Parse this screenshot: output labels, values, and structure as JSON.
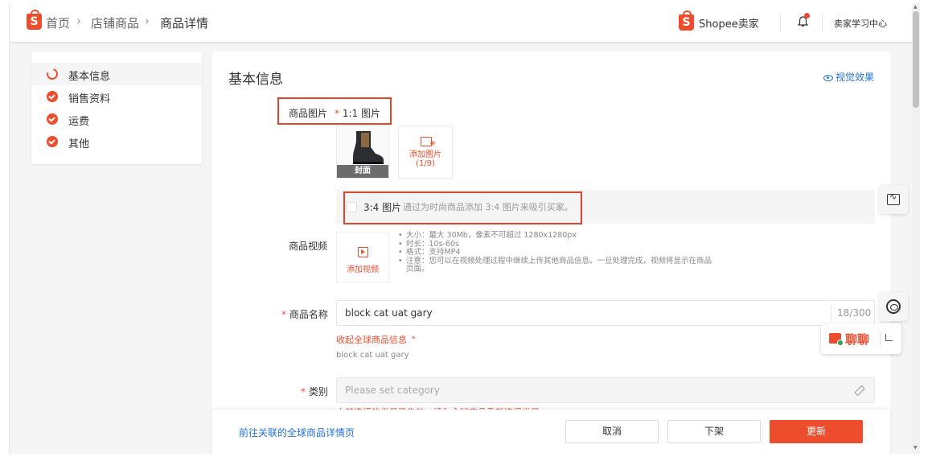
{
  "breadcrumb": {
    "home": "首页",
    "products": "店铺商品",
    "current": "商品详情"
  },
  "header": {
    "seller_center": "Shopee卖家",
    "learning_center": "卖家学习中心"
  },
  "sidenav": {
    "items": [
      {
        "label": "基本信息",
        "status": "in-progress"
      },
      {
        "label": "销售资料",
        "status": "done"
      },
      {
        "label": "运费",
        "status": "done"
      },
      {
        "label": "其他",
        "status": "done"
      }
    ]
  },
  "section": {
    "title": "基本信息",
    "visual_effect": "视觉效果"
  },
  "product_images": {
    "label": "商品图片",
    "ratio": "1:1 图片",
    "cover_label": "封面",
    "add_label": "添加图片",
    "add_count": "(1/9)"
  },
  "ratio34": {
    "label": "3:4 图片",
    "hint": "通过为时尚商品添加 3:4 图片来吸引买家。"
  },
  "product_video": {
    "label": "商品视频",
    "add_label": "添加视频",
    "specs": [
      "大小：最大 30Mb，像素不可超过 1280x1280px",
      "时长：10s-60s",
      "格式：支持MP4",
      "注意：您可以在视频处理过程中继续上传其他商品信息。一旦处理完成，视频将显示在商品"
    ],
    "specs_cont": "页面。"
  },
  "product_name": {
    "label": "商品名称",
    "value": "block cat uat gary",
    "count": "18/300",
    "collapse_label": "收起全球商品信息",
    "global_name": "block cat uat gary"
  },
  "category": {
    "label": "类别",
    "placeholder": "Please set category",
    "warning": "之前选择的类目已失效，请为全球商品重新选择类目"
  },
  "footer": {
    "link": "前往关联的全球商品详情页",
    "cancel": "取消",
    "delist": "下架",
    "update": "更新"
  },
  "chat": {
    "label": "聊聊"
  },
  "colors": {
    "brand": "#ee4d2d",
    "link": "#2673dd"
  }
}
